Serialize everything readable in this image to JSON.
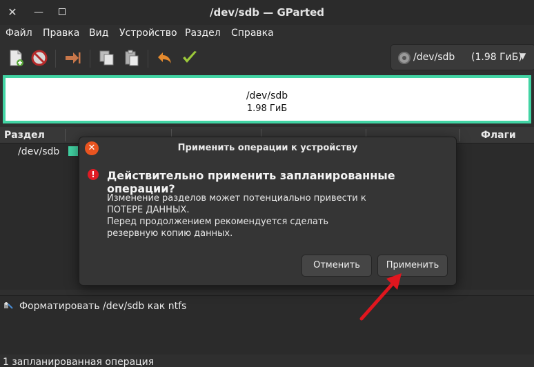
{
  "window": {
    "title": "/dev/sdb — GParted"
  },
  "menu": {
    "items": [
      "Файл",
      "Правка",
      "Вид",
      "Устройство",
      "Раздел",
      "Справка"
    ]
  },
  "toolbar": {
    "icons": [
      "new-partition-icon",
      "delete-icon",
      "resize-move-icon",
      "copy-icon",
      "paste-icon",
      "undo-icon",
      "apply-icon"
    ]
  },
  "device_selector": {
    "device": "/dev/sdb",
    "size": "(1.98 ГиБ)"
  },
  "disk_map": {
    "device": "/dev/sdb",
    "size": "1.98 ГиБ",
    "partition_color": "#42d4a4"
  },
  "table": {
    "columns": [
      "Раздел",
      "Флаги"
    ],
    "rows": [
      {
        "partition": "/dev/sdb"
      }
    ]
  },
  "operations": {
    "items": [
      "Форматировать /dev/sdb как ntfs"
    ],
    "status": "1 запланированная операция"
  },
  "dialog": {
    "title": "Применить операции к устройству",
    "heading": "Действительно применить запланированные операции?",
    "body_lines": [
      "Изменение разделов может потенциально привести к",
      "ПОТЕРЕ ДАННЫХ.",
      "Перед продолжением рекомендуется сделать",
      "резервную копию данных."
    ],
    "cancel_label": "Отменить",
    "apply_label": "Применить"
  },
  "colors": {
    "accent": "#42d4a4",
    "close_button": "#e95420",
    "warning": "#e01b24",
    "arrow": "#e0161e"
  }
}
